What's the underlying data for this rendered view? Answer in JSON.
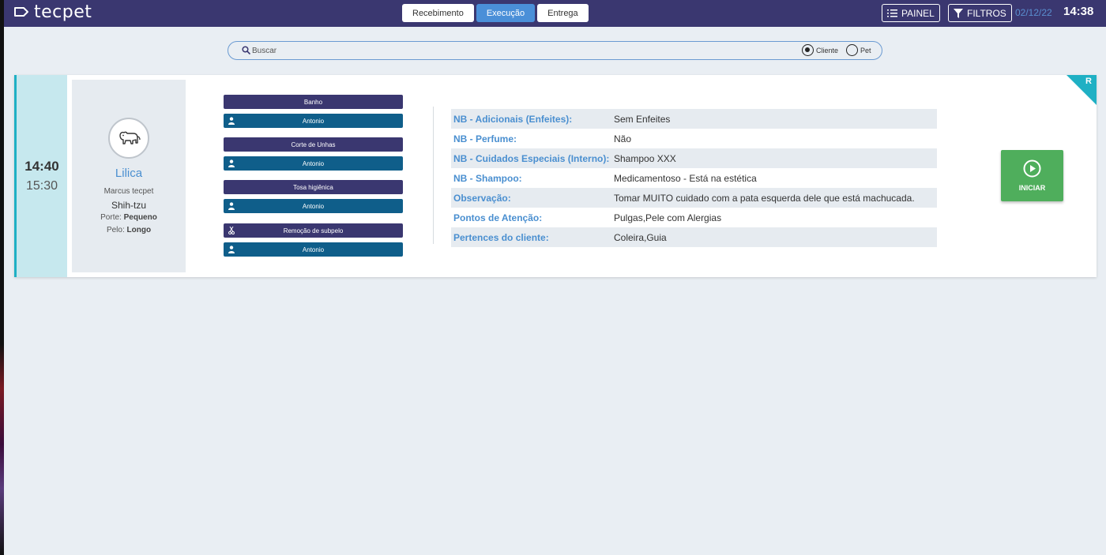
{
  "app": {
    "logo_text": "tecpet"
  },
  "tabs": [
    {
      "label": "Recebimento"
    },
    {
      "label": "Execução"
    },
    {
      "label": "Entrega"
    }
  ],
  "header": {
    "painel_label": "PAINEL",
    "filtros_label": "FILTROS",
    "date": "02/12/22",
    "time": "14:38"
  },
  "search": {
    "placeholder": "Buscar",
    "radio_options": [
      "Cliente",
      "Pet"
    ],
    "selected": "Cliente"
  },
  "card": {
    "start_time": "14:40",
    "end_time": "15:30",
    "corner_badge": "R",
    "pet": {
      "name": "Lilica",
      "owner": "Marcus tecpet",
      "breed": "Shih-tzu",
      "size_label": "Porte:",
      "size_value": "Pequeno",
      "coat_label": "Pelo:",
      "coat_value": "Longo"
    },
    "services": [
      {
        "name": "Banho",
        "staff": "Antonio",
        "icon": "none"
      },
      {
        "name": "Corte de Unhas",
        "staff": "Antonio",
        "icon": "none"
      },
      {
        "name": "Tosa higiênica",
        "staff": "Antonio",
        "icon": "none"
      },
      {
        "name": "Remoção de subpelo",
        "staff": "Antonio",
        "icon": "scissors-icon"
      }
    ],
    "details": [
      {
        "label": "NB - Adicionais (Enfeites):",
        "value": "Sem Enfeites"
      },
      {
        "label": "NB - Perfume:",
        "value": "Não"
      },
      {
        "label": "NB - Cuidados Especiais (Interno):",
        "value": "Shampoo XXX"
      },
      {
        "label": "NB - Shampoo:",
        "value": "Medicamentoso - Está na estética"
      },
      {
        "label": "Observação:",
        "value": "Tomar MUITO cuidado com a pata esquerda dele que está machucada."
      },
      {
        "label": "Pontos de Atenção:",
        "value": "Pulgas,Pele com Alergias"
      },
      {
        "label": "Pertences do cliente:",
        "value": "Coleira,Guia"
      }
    ],
    "start_button_label": "INICIAR"
  },
  "colors": {
    "topbar": "#3a3770",
    "accent": "#4a8fd8",
    "teal": "#1fb0c4",
    "start_green": "#4fae5c"
  }
}
